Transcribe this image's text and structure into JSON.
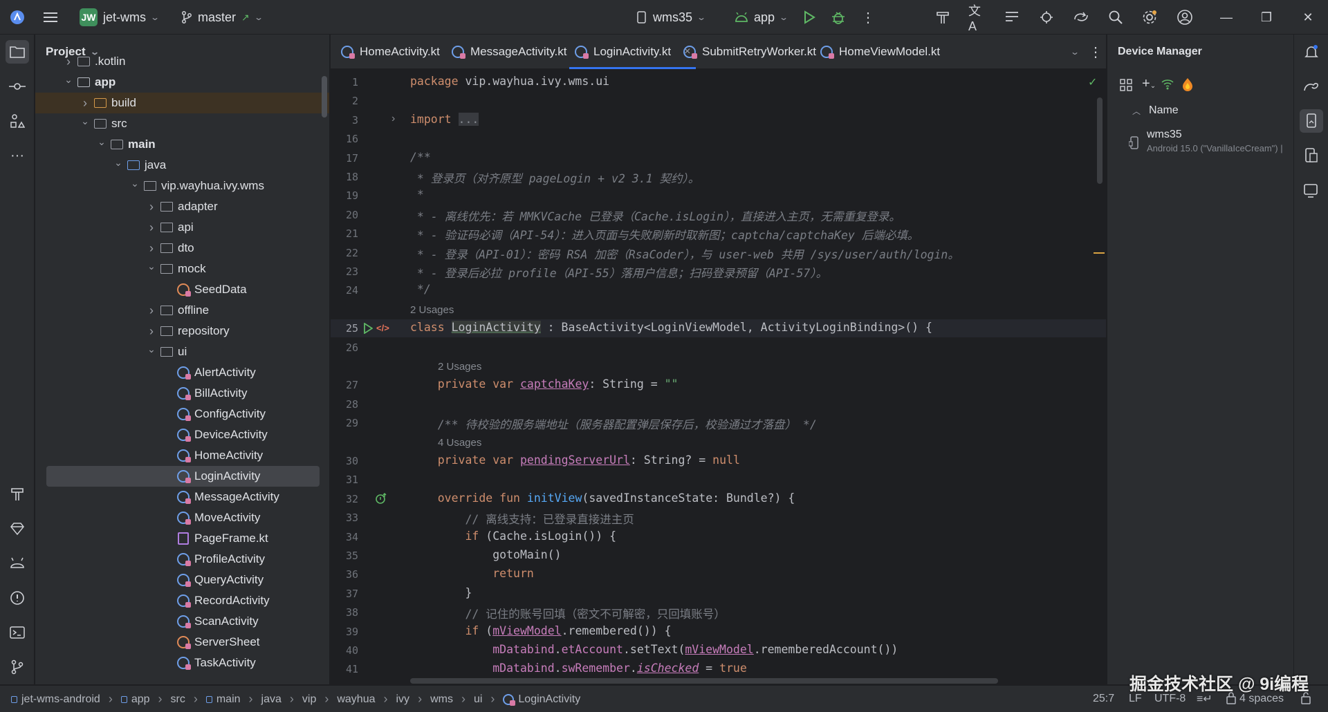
{
  "titlebar": {
    "project_badge": "JW",
    "project_name": "jet-wms",
    "branch": "master",
    "device": "wms35",
    "run_config": "app",
    "window_controls": [
      "minimize",
      "restore",
      "close"
    ]
  },
  "project_panel": {
    "title": "Project",
    "tree": [
      {
        "label": ".kotlin",
        "indent": 1,
        "arrow": "right",
        "icon": "folder"
      },
      {
        "label": "app",
        "indent": 1,
        "arrow": "down",
        "icon": "module",
        "bold": true
      },
      {
        "label": "build",
        "indent": 2,
        "arrow": "right",
        "icon": "folder-orange",
        "build": true
      },
      {
        "label": "src",
        "indent": 2,
        "arrow": "down",
        "icon": "folder"
      },
      {
        "label": "main",
        "indent": 3,
        "arrow": "down",
        "icon": "folder",
        "bold": true
      },
      {
        "label": "java",
        "indent": 4,
        "arrow": "down",
        "icon": "folder-blue"
      },
      {
        "label": "vip.wayhua.ivy.wms",
        "indent": 5,
        "arrow": "down",
        "icon": "package"
      },
      {
        "label": "adapter",
        "indent": 6,
        "arrow": "right",
        "icon": "package"
      },
      {
        "label": "api",
        "indent": 6,
        "arrow": "right",
        "icon": "package"
      },
      {
        "label": "dto",
        "indent": 6,
        "arrow": "right",
        "icon": "package"
      },
      {
        "label": "mock",
        "indent": 6,
        "arrow": "down",
        "icon": "package"
      },
      {
        "label": "SeedData",
        "indent": 7,
        "arrow": "",
        "icon": "kobject"
      },
      {
        "label": "offline",
        "indent": 6,
        "arrow": "right",
        "icon": "package"
      },
      {
        "label": "repository",
        "indent": 6,
        "arrow": "right",
        "icon": "package"
      },
      {
        "label": "ui",
        "indent": 6,
        "arrow": "down",
        "icon": "package"
      },
      {
        "label": "AlertActivity",
        "indent": 7,
        "arrow": "",
        "icon": "kclass"
      },
      {
        "label": "BillActivity",
        "indent": 7,
        "arrow": "",
        "icon": "kclass"
      },
      {
        "label": "ConfigActivity",
        "indent": 7,
        "arrow": "",
        "icon": "kclass"
      },
      {
        "label": "DeviceActivity",
        "indent": 7,
        "arrow": "",
        "icon": "kclass"
      },
      {
        "label": "HomeActivity",
        "indent": 7,
        "arrow": "",
        "icon": "kclass"
      },
      {
        "label": "LoginActivity",
        "indent": 7,
        "arrow": "",
        "icon": "kclass",
        "selected": true
      },
      {
        "label": "MessageActivity",
        "indent": 7,
        "arrow": "",
        "icon": "kclass"
      },
      {
        "label": "MoveActivity",
        "indent": 7,
        "arrow": "",
        "icon": "kclass"
      },
      {
        "label": "PageFrame.kt",
        "indent": 7,
        "arrow": "",
        "icon": "kfile"
      },
      {
        "label": "ProfileActivity",
        "indent": 7,
        "arrow": "",
        "icon": "kclass"
      },
      {
        "label": "QueryActivity",
        "indent": 7,
        "arrow": "",
        "icon": "kclass"
      },
      {
        "label": "RecordActivity",
        "indent": 7,
        "arrow": "",
        "icon": "kclass"
      },
      {
        "label": "ScanActivity",
        "indent": 7,
        "arrow": "",
        "icon": "kclass"
      },
      {
        "label": "ServerSheet",
        "indent": 7,
        "arrow": "",
        "icon": "kobject"
      },
      {
        "label": "TaskActivity",
        "indent": 7,
        "arrow": "",
        "icon": "kclass"
      }
    ]
  },
  "tabs": [
    {
      "label": "HomeActivity.kt",
      "active": false
    },
    {
      "label": "MessageActivity.kt",
      "active": false
    },
    {
      "label": "LoginActivity.kt",
      "active": true
    },
    {
      "label": "SubmitRetryWorker.kt",
      "active": false
    },
    {
      "label": "HomeViewModel.kt",
      "active": false
    }
  ],
  "editor": {
    "caret_position": "25:7",
    "lines": [
      {
        "n": "1",
        "html": "<span class='kw'>package</span> vip.wayhua.ivy.wms.ui"
      },
      {
        "n": "2",
        "html": ""
      },
      {
        "n": "3",
        "html": "<span class='kw'>import</span> <span style='background:#393b40;color:#868a91'>...</span>",
        "fold": true
      },
      {
        "n": "16",
        "html": ""
      },
      {
        "n": "17",
        "html": "<span class='cmt'>/**</span>"
      },
      {
        "n": "18",
        "html": "<span class='cmt'> * 登录页（对齐原型 pageLogin + v2 3.1 契约）。</span>"
      },
      {
        "n": "19",
        "html": "<span class='cmt'> *</span>"
      },
      {
        "n": "20",
        "html": "<span class='cmt'> * - 离线优先：若 MMKVCache 已登录（Cache.isLogin），直接进入主页，无需重复登录。</span>"
      },
      {
        "n": "21",
        "html": "<span class='cmt'> * - 验证码必调（API-54）：进入页面与失败刷新时取新图；captcha/captchaKey 后端必填。</span>"
      },
      {
        "n": "22",
        "html": "<span class='cmt'> * - 登录（API-01）：密码 RSA 加密（RsaCoder），与 user-web 共用 /sys/user/auth/login。</span>"
      },
      {
        "n": "23",
        "html": "<span class='cmt'> * - 登录后必拉 profile（API-55）落用户信息；扫码登录预留（API-57）。</span>"
      },
      {
        "n": "24",
        "html": "<span class='cmt'> */</span>"
      },
      {
        "usages": "2 Usages",
        "indent": 0
      },
      {
        "n": "25",
        "html": "<span class='kw'>class</span> <span class='cls-hl'>LoginActivity</span> : BaseActivity&lt;LoginViewModel, ActivityLoginBinding&gt;() {",
        "current": true,
        "gutter": "run"
      },
      {
        "n": "26",
        "html": ""
      },
      {
        "usages": "2 Usages",
        "indent": 1
      },
      {
        "n": "27",
        "html": "    <span class='kw'>private var</span> <span class='prop'>captchaKey</span>: String = <span class='str'>\"\"</span>"
      },
      {
        "n": "28",
        "html": ""
      },
      {
        "n": "29",
        "html": "    <span class='cmt'>/** 待校验的服务端地址（服务器配置弹层保存后，校验通过才落盘） */</span>"
      },
      {
        "usages": "4 Usages",
        "indent": 1
      },
      {
        "n": "30",
        "html": "    <span class='kw'>private var</span> <span class='prop'>pendingServerUrl</span>: String? = <span class='kw'>null</span>"
      },
      {
        "n": "31",
        "html": ""
      },
      {
        "n": "32",
        "html": "    <span class='kw'>override fun</span> <span class='fn'>initView</span>(savedInstanceState: Bundle?) {",
        "gutter": "override"
      },
      {
        "n": "33",
        "html": "        <span class='cmt' style='font-style:normal'>// 离线支持：已登录直接进主页</span>"
      },
      {
        "n": "34",
        "html": "        <span class='kw'>if</span> (Cache.isLogin()) {"
      },
      {
        "n": "35",
        "html": "            gotoMain()"
      },
      {
        "n": "36",
        "html": "            <span class='kw'>return</span>"
      },
      {
        "n": "37",
        "html": "        }"
      },
      {
        "n": "38",
        "html": "        <span class='cmt' style='font-style:normal'>// 记住的账号回填（密文不可解密，只回填账号）</span>"
      },
      {
        "n": "39",
        "html": "        <span class='kw'>if</span> (<span class='prop'>mViewModel</span>.remembered()) {"
      },
      {
        "n": "40",
        "html": "            <span style='color:#c77dbb'>mDatabind</span>.<span style='color:#c77dbb'>etAccount</span>.setText(<span class='prop'>mViewModel</span>.rememberedAccount())"
      },
      {
        "n": "41",
        "html": "            <span style='color:#c77dbb'>mDatabind</span>.<span style='color:#c77dbb'>swRemember</span>.<span class='propi'>isChecked</span> = <span class='kw'>true</span>"
      }
    ]
  },
  "device_manager": {
    "title": "Device Manager",
    "column_name": "Name",
    "devices": [
      {
        "name": "wms35",
        "detail": "Android 15.0 (\"VanillaIceCream\") |"
      }
    ]
  },
  "statusbar": {
    "breadcrumbs": [
      "jet-wms-android",
      "app",
      "src",
      "main",
      "java",
      "vip",
      "wayhua",
      "ivy",
      "wms",
      "ui",
      "LoginActivity"
    ],
    "position": "25:7",
    "line_ending": "LF",
    "encoding": "UTF-8",
    "indent": "4 spaces"
  },
  "watermark": "掘金技术社区 @ 9i编程",
  "colors": {
    "accent": "#3574f0",
    "keyword": "#cf8e6d",
    "comment": "#7a7e85",
    "string": "#6aab73",
    "function": "#56a8f5",
    "property": "#c77dbb"
  }
}
